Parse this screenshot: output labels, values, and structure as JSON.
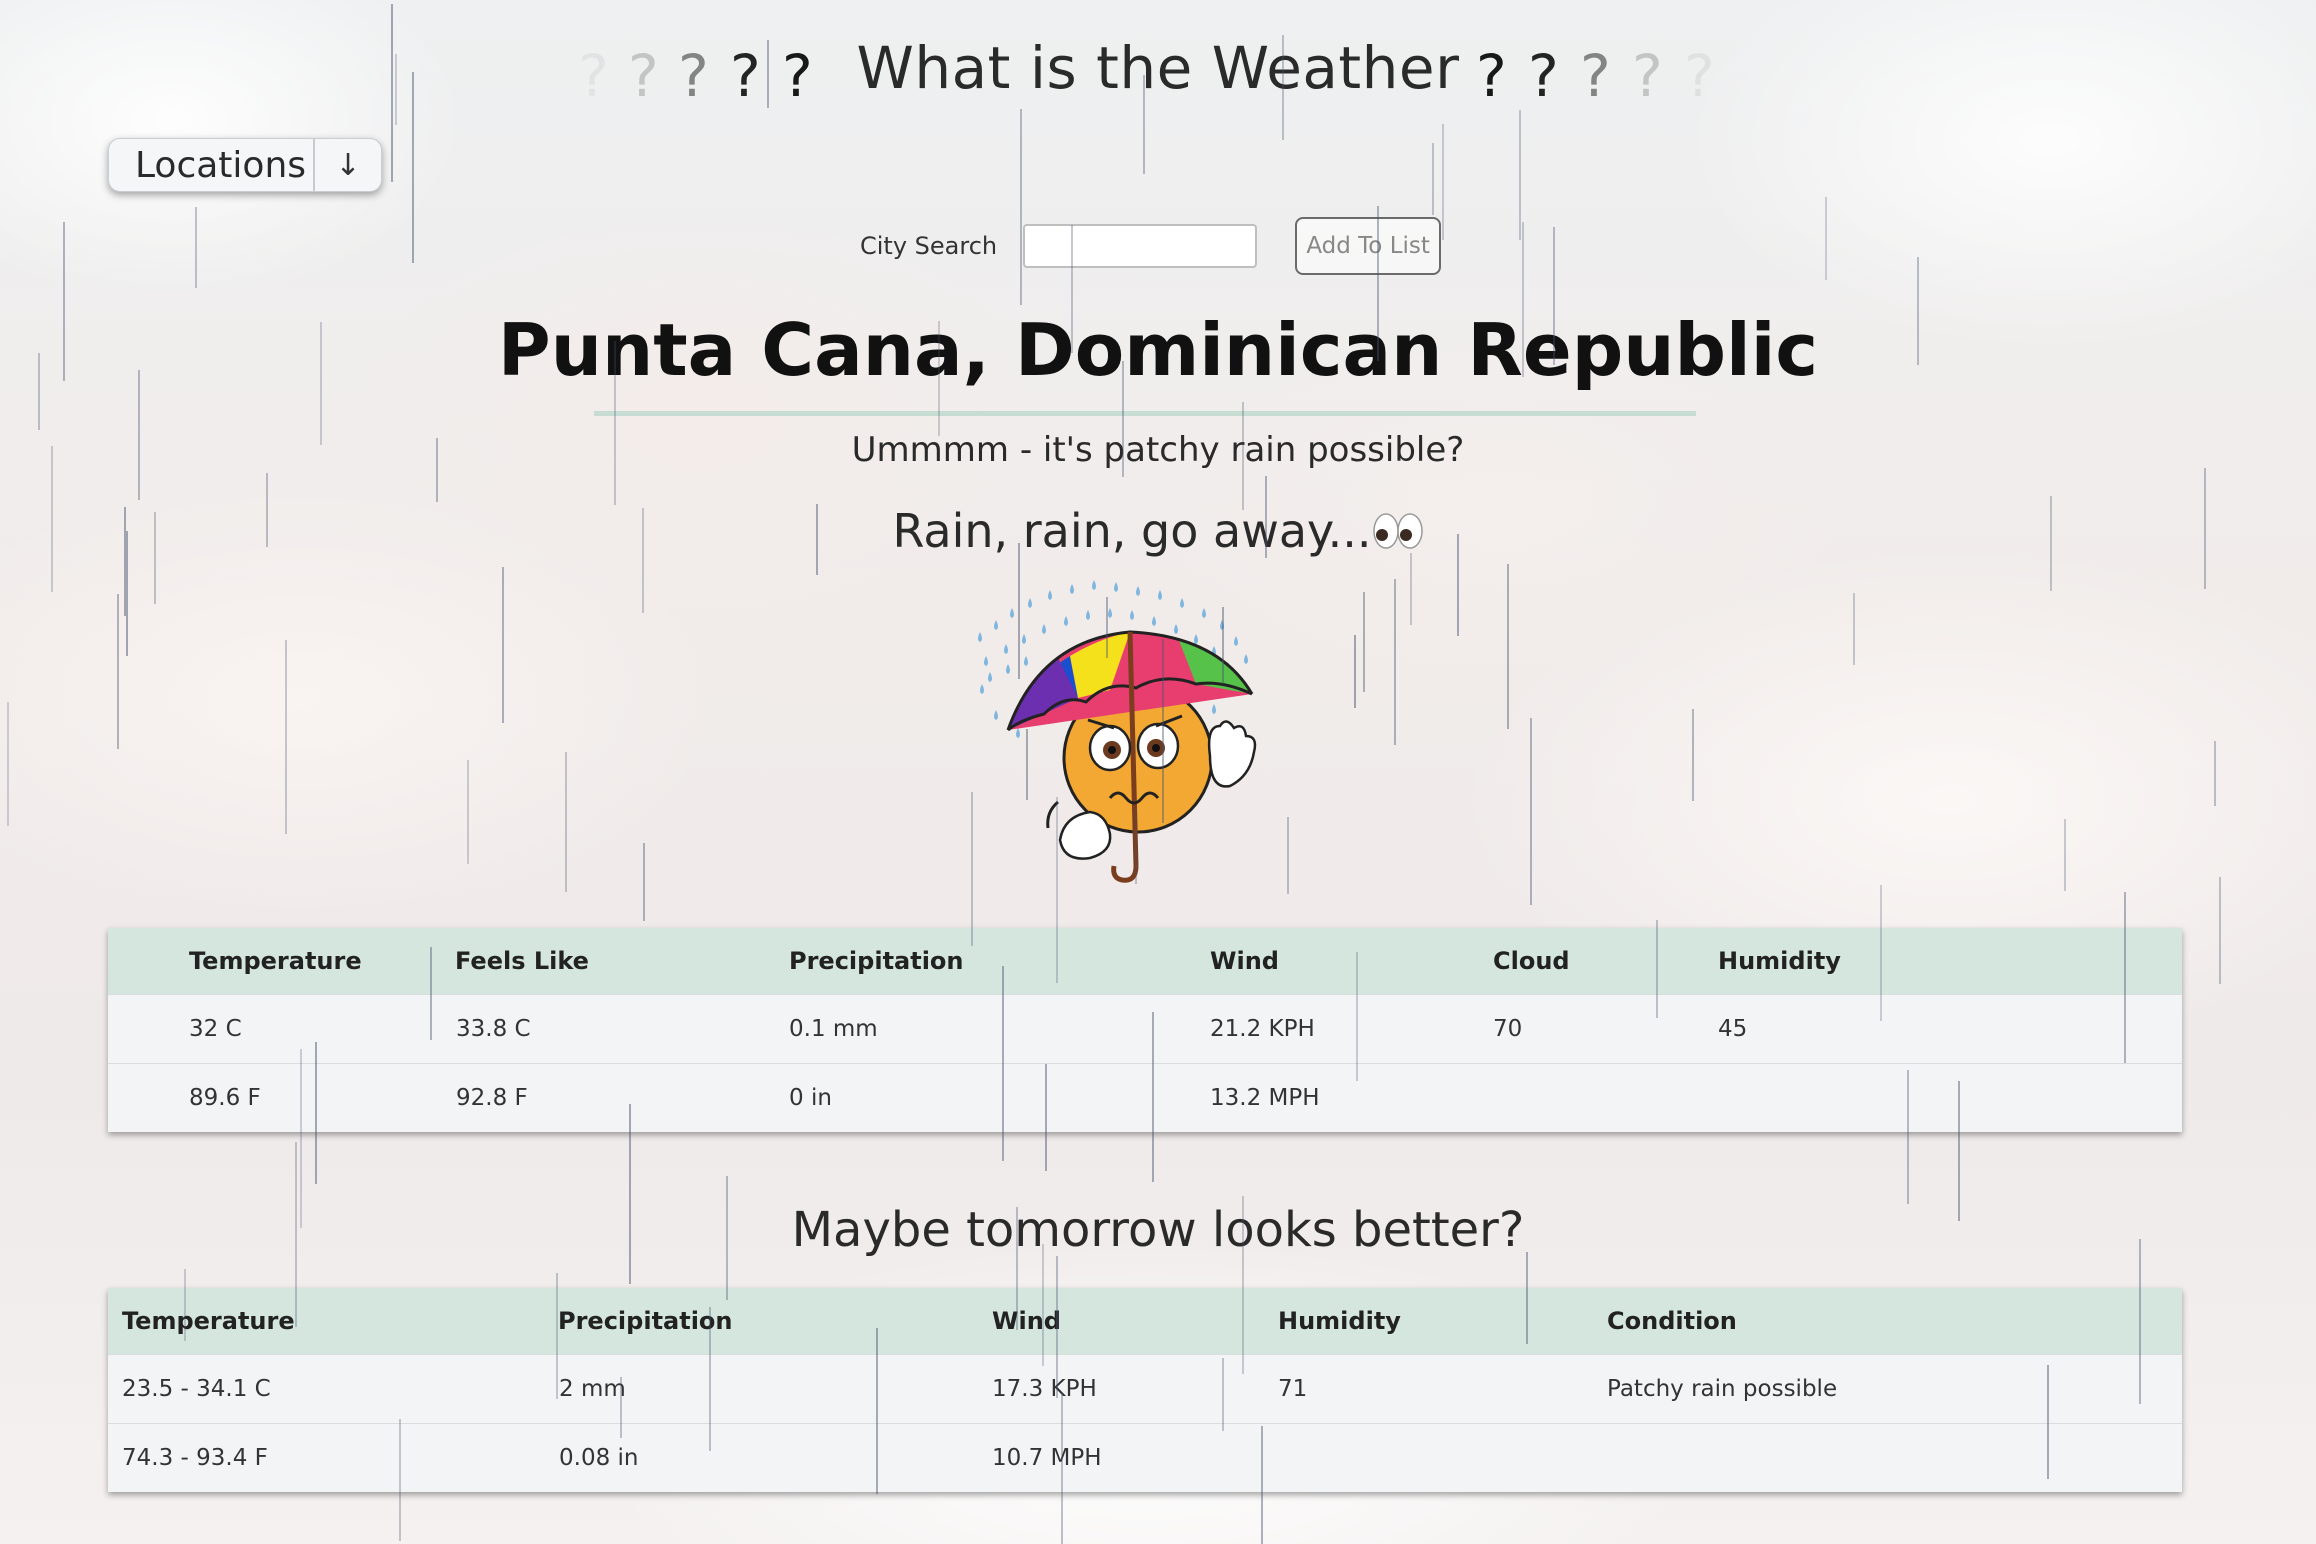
{
  "header": {
    "title": "What is the Weather",
    "left_marks": [
      "?",
      "?",
      "?",
      "?",
      "?"
    ],
    "right_marks": [
      "?",
      "?",
      "?",
      "?",
      "?"
    ]
  },
  "locations_button": {
    "label": "Locations",
    "arrow": "↓"
  },
  "search": {
    "label": "City Search",
    "value": "",
    "add_button": "Add To List"
  },
  "city": "Punta Cana, Dominican Republic",
  "condition_text": "Ummmm - it's patchy rain possible?",
  "quip": "Rain, rain, go away...",
  "emoji_icon": "rain-umbrella-worried-face",
  "current": {
    "headers": [
      "Temperature",
      "Feels Like",
      "Precipitation",
      "Wind",
      "Cloud",
      "Humidity"
    ],
    "rows": [
      [
        "32 C",
        "33.8 C",
        "0.1 mm",
        "21.2 KPH",
        "70",
        "45"
      ],
      [
        "89.6 F",
        "92.8 F",
        "0 in",
        "13.2 MPH",
        "",
        ""
      ]
    ]
  },
  "tomorrow": {
    "heading": "Maybe tomorrow looks better?",
    "headers": [
      "Temperature",
      "Precipitation",
      "Wind",
      "Humidity",
      "Condition"
    ],
    "rows": [
      [
        "23.5 - 34.1 C",
        "2 mm",
        "17.3 KPH",
        "71",
        "Patchy rain possible"
      ],
      [
        "74.3 - 93.4 F",
        "0.08 in",
        "10.7 MPH",
        "",
        ""
      ]
    ]
  },
  "colors": {
    "table_header": "#d5e6df",
    "city_underline": "#c7ddd4",
    "rain": "#4a5570"
  }
}
